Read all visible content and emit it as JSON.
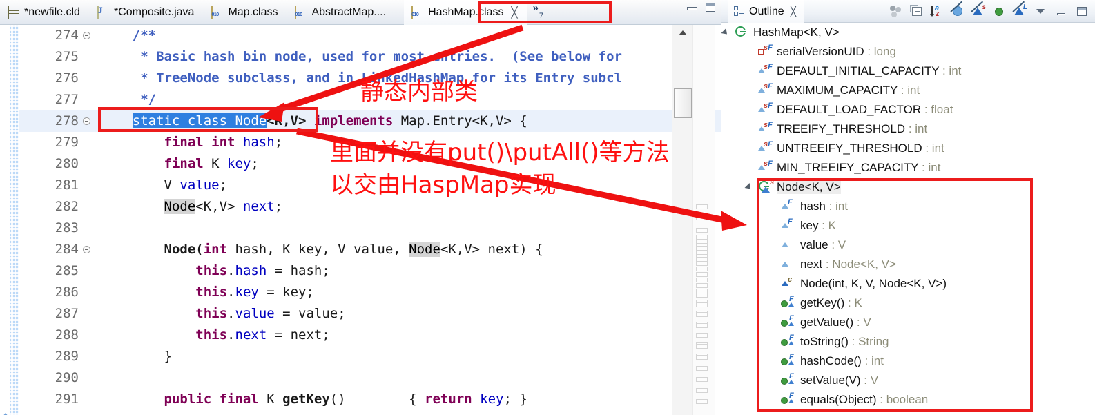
{
  "editor": {
    "tabs": [
      {
        "label": "*newfile.cld",
        "icon": "cld-file-icon",
        "active": false,
        "closable": false
      },
      {
        "label": "*Composite.java",
        "icon": "java-file-icon",
        "active": false,
        "closable": false
      },
      {
        "label": "Map.class",
        "icon": "class-file-icon",
        "active": false,
        "closable": false
      },
      {
        "label": "AbstractMap....",
        "icon": "class-file-icon",
        "active": false,
        "closable": false
      },
      {
        "label": "HashMap.class",
        "icon": "class-file-icon",
        "active": true,
        "closable": true
      }
    ],
    "close_glyph": "╳",
    "overflow_glyph": "»",
    "overflow_count": "7",
    "window_buttons": [
      "minimize-button",
      "maximize-button"
    ],
    "lines": [
      {
        "num": "274",
        "fold": true,
        "current": false,
        "segments": [
          {
            "t": "    ",
            "c": "plain"
          },
          {
            "t": "/**",
            "c": "cmtb"
          }
        ]
      },
      {
        "num": "275",
        "fold": false,
        "current": false,
        "segments": [
          {
            "t": "     * Basic hash bin node, used for most entries.  (See below for",
            "c": "cmtb"
          }
        ]
      },
      {
        "num": "276",
        "fold": false,
        "current": false,
        "segments": [
          {
            "t": "     * TreeNode subclass, and in LinkedHashMap for its Entry subcl",
            "c": "cmtb"
          }
        ]
      },
      {
        "num": "277",
        "fold": false,
        "current": false,
        "segments": [
          {
            "t": "     */",
            "c": "cmtb"
          }
        ]
      },
      {
        "num": "278",
        "fold": true,
        "current": true,
        "segments": [
          {
            "t": "    ",
            "c": "plain"
          },
          {
            "t": "static class Node",
            "c": "sel"
          },
          {
            "t": "<K,V>",
            "c": "type"
          },
          {
            "t": " implements ",
            "c": "kw"
          },
          {
            "t": "Map.Entry<K,V> {",
            "c": "plain"
          }
        ]
      },
      {
        "num": "279",
        "fold": false,
        "current": false,
        "segments": [
          {
            "t": "        ",
            "c": "plain"
          },
          {
            "t": "final int",
            "c": "kw"
          },
          {
            "t": " ",
            "c": "plain"
          },
          {
            "t": "hash",
            "c": "fld"
          },
          {
            "t": ";",
            "c": "plain"
          }
        ]
      },
      {
        "num": "280",
        "fold": false,
        "current": false,
        "segments": [
          {
            "t": "        ",
            "c": "plain"
          },
          {
            "t": "final",
            "c": "kw"
          },
          {
            "t": " K ",
            "c": "plain"
          },
          {
            "t": "key",
            "c": "fld"
          },
          {
            "t": ";",
            "c": "plain"
          }
        ]
      },
      {
        "num": "281",
        "fold": false,
        "current": false,
        "segments": [
          {
            "t": "        V ",
            "c": "plain"
          },
          {
            "t": "value",
            "c": "fld"
          },
          {
            "t": ";",
            "c": "plain"
          }
        ]
      },
      {
        "num": "282",
        "fold": false,
        "current": false,
        "segments": [
          {
            "t": "        ",
            "c": "plain"
          },
          {
            "t": "Node",
            "c": "occ"
          },
          {
            "t": "<K,V> ",
            "c": "plain"
          },
          {
            "t": "next",
            "c": "fld"
          },
          {
            "t": ";",
            "c": "plain"
          }
        ]
      },
      {
        "num": "283",
        "fold": false,
        "current": false,
        "segments": [
          {
            "t": "",
            "c": "plain"
          }
        ]
      },
      {
        "num": "284",
        "fold": true,
        "current": false,
        "segments": [
          {
            "t": "        ",
            "c": "plain"
          },
          {
            "t": "Node(",
            "c": "type"
          },
          {
            "t": "int",
            "c": "kw"
          },
          {
            "t": " hash, K key, V value, ",
            "c": "plain"
          },
          {
            "t": "Node",
            "c": "occ"
          },
          {
            "t": "<K,V> next) {",
            "c": "plain"
          }
        ]
      },
      {
        "num": "285",
        "fold": false,
        "current": false,
        "segments": [
          {
            "t": "            ",
            "c": "plain"
          },
          {
            "t": "this",
            "c": "kw"
          },
          {
            "t": ".",
            "c": "plain"
          },
          {
            "t": "hash",
            "c": "fld"
          },
          {
            "t": " = hash;",
            "c": "plain"
          }
        ]
      },
      {
        "num": "286",
        "fold": false,
        "current": false,
        "segments": [
          {
            "t": "            ",
            "c": "plain"
          },
          {
            "t": "this",
            "c": "kw"
          },
          {
            "t": ".",
            "c": "plain"
          },
          {
            "t": "key",
            "c": "fld"
          },
          {
            "t": " = key;",
            "c": "plain"
          }
        ]
      },
      {
        "num": "287",
        "fold": false,
        "current": false,
        "segments": [
          {
            "t": "            ",
            "c": "plain"
          },
          {
            "t": "this",
            "c": "kw"
          },
          {
            "t": ".",
            "c": "plain"
          },
          {
            "t": "value",
            "c": "fld"
          },
          {
            "t": " = value;",
            "c": "plain"
          }
        ]
      },
      {
        "num": "288",
        "fold": false,
        "current": false,
        "segments": [
          {
            "t": "            ",
            "c": "plain"
          },
          {
            "t": "this",
            "c": "kw"
          },
          {
            "t": ".",
            "c": "plain"
          },
          {
            "t": "next",
            "c": "fld"
          },
          {
            "t": " = next;",
            "c": "plain"
          }
        ]
      },
      {
        "num": "289",
        "fold": false,
        "current": false,
        "segments": [
          {
            "t": "        }",
            "c": "plain"
          }
        ]
      },
      {
        "num": "290",
        "fold": false,
        "current": false,
        "segments": [
          {
            "t": "",
            "c": "plain"
          }
        ]
      },
      {
        "num": "291",
        "fold": false,
        "current": false,
        "segments": [
          {
            "t": "        ",
            "c": "plain"
          },
          {
            "t": "public final",
            "c": "kw"
          },
          {
            "t": " K ",
            "c": "plain"
          },
          {
            "t": "getKey",
            "c": "type"
          },
          {
            "t": "()        { ",
            "c": "plain"
          },
          {
            "t": "return",
            "c": "kw"
          },
          {
            "t": " ",
            "c": "plain"
          },
          {
            "t": "key",
            "c": "fld"
          },
          {
            "t": "; }",
            "c": "plain"
          }
        ]
      }
    ]
  },
  "outline": {
    "title": "Outline",
    "close_glyph": "╳",
    "toolbar_icons": [
      "hierarchy-icon",
      "collapse-all-icon",
      "sort-az-icon",
      "hide-nonpublic-icon",
      "hide-static-icon",
      "hide-fields-icon",
      "hide-local-types-icon",
      "view-menu-icon",
      "minimize-icon",
      "maximize-icon"
    ],
    "items": [
      {
        "label": "HashMap<K, V>",
        "type": "",
        "icon": "class-icon",
        "indent": 0,
        "twisty": true,
        "selected": false
      },
      {
        "label": "serialVersionUID",
        "type": " : long",
        "icon": "private-static-field-icon",
        "indent": 1,
        "twisty": false,
        "selected": false
      },
      {
        "label": "DEFAULT_INITIAL_CAPACITY",
        "type": " : int",
        "icon": "static-field-icon",
        "indent": 1,
        "twisty": false,
        "selected": false
      },
      {
        "label": "MAXIMUM_CAPACITY",
        "type": " : int",
        "icon": "static-field-icon",
        "indent": 1,
        "twisty": false,
        "selected": false
      },
      {
        "label": "DEFAULT_LOAD_FACTOR",
        "type": " : float",
        "icon": "static-field-icon",
        "indent": 1,
        "twisty": false,
        "selected": false
      },
      {
        "label": "TREEIFY_THRESHOLD",
        "type": " : int",
        "icon": "static-field-icon",
        "indent": 1,
        "twisty": false,
        "selected": false
      },
      {
        "label": "UNTREEIFY_THRESHOLD",
        "type": " : int",
        "icon": "static-field-icon",
        "indent": 1,
        "twisty": false,
        "selected": false
      },
      {
        "label": "MIN_TREEIFY_CAPACITY",
        "type": " : int",
        "icon": "static-field-icon",
        "indent": 1,
        "twisty": false,
        "selected": false
      },
      {
        "label": "Node<K, V>",
        "type": "",
        "icon": "inner-class-icon",
        "indent": 1,
        "twisty": true,
        "selected": true
      },
      {
        "label": "hash",
        "type": " : int",
        "icon": "field-icon",
        "indent": 2,
        "twisty": false,
        "selected": false
      },
      {
        "label": "key",
        "type": " : K",
        "icon": "field-icon",
        "indent": 2,
        "twisty": false,
        "selected": false
      },
      {
        "label": "value",
        "type": " : V",
        "icon": "field-plain-icon",
        "indent": 2,
        "twisty": false,
        "selected": false
      },
      {
        "label": "next",
        "type": " : Node<K, V>",
        "icon": "field-plain-icon",
        "indent": 2,
        "twisty": false,
        "selected": false
      },
      {
        "label": "Node(int, K, V, Node<K, V>)",
        "type": "",
        "icon": "constructor-icon",
        "indent": 2,
        "twisty": false,
        "selected": false
      },
      {
        "label": "getKey()",
        "type": " : K",
        "icon": "method-icon",
        "indent": 2,
        "twisty": false,
        "selected": false
      },
      {
        "label": "getValue()",
        "type": " : V",
        "icon": "method-icon",
        "indent": 2,
        "twisty": false,
        "selected": false
      },
      {
        "label": "toString()",
        "type": " : String",
        "icon": "method-icon",
        "indent": 2,
        "twisty": false,
        "selected": false
      },
      {
        "label": "hashCode()",
        "type": " : int",
        "icon": "method-icon",
        "indent": 2,
        "twisty": false,
        "selected": false
      },
      {
        "label": "setValue(V)",
        "type": " : V",
        "icon": "method-icon",
        "indent": 2,
        "twisty": false,
        "selected": false
      },
      {
        "label": "equals(Object)",
        "type": " : boolean",
        "icon": "method-icon",
        "indent": 2,
        "twisty": false,
        "selected": false
      }
    ]
  },
  "annotations": {
    "color": "#ff1010",
    "note_static_inner_class": "静态内部类",
    "note_no_put_line1": "里面并没有put()\\putAll()等方法",
    "note_no_put_line2": "以交由HaspMap实现",
    "boxes": [
      {
        "name": "highlight-box-hashmap-tab"
      },
      {
        "name": "highlight-box-node-declaration"
      },
      {
        "name": "highlight-box-outline-node"
      }
    ],
    "arrows": [
      {
        "name": "arrow-tab-to-node-declaration"
      },
      {
        "name": "arrow-node-declaration-to-outline"
      }
    ]
  }
}
